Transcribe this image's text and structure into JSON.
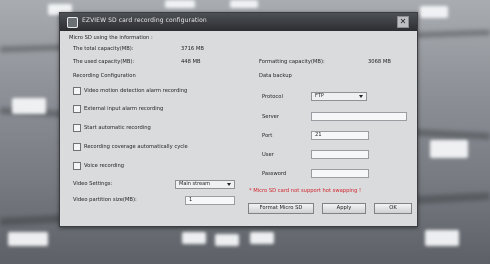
{
  "dialog": {
    "title": "EZVIEW SD card recording configuration",
    "close_glyph": "✕"
  },
  "info": {
    "header": "Micro SD using the information :",
    "total_label": "The total capacity(MB):",
    "total_value": "3716 MB",
    "used_label": "The used capacity(MB):",
    "used_value": "448 MB",
    "formatting_label": "Formatting capacity(MB):",
    "formatting_value": "3068 MB"
  },
  "recording": {
    "header": "Recording Configuration",
    "options": [
      {
        "label": "Video motion detection alarm recording",
        "checked": false
      },
      {
        "label": "External input alarm recording",
        "checked": false
      },
      {
        "label": "Start automatic recording",
        "checked": false
      },
      {
        "label": "Recording coverage automatically cycle",
        "checked": false
      },
      {
        "label": "Voice recording",
        "checked": false
      }
    ],
    "video_settings_label": "Video Settings:",
    "video_settings_value": "Main stream",
    "partition_label": "Video partition size(MB):",
    "partition_value": "1"
  },
  "backup": {
    "header": "Data backup",
    "protocol_label": "Protocol",
    "protocol_value": "FTP",
    "server_label": "Server",
    "server_value": "",
    "port_label": "Port",
    "port_value": "21",
    "user_label": "User",
    "user_value": "",
    "password_label": "Password",
    "password_value": ""
  },
  "warning": "* Micro SD card not support hot swapping !",
  "buttons": {
    "format": "Format Micro SD",
    "apply": "Apply",
    "ok": "OK"
  },
  "colors": {
    "titlebar": "#2c2e31",
    "dialog": "#d9dbdd",
    "warning": "#d2222a"
  }
}
